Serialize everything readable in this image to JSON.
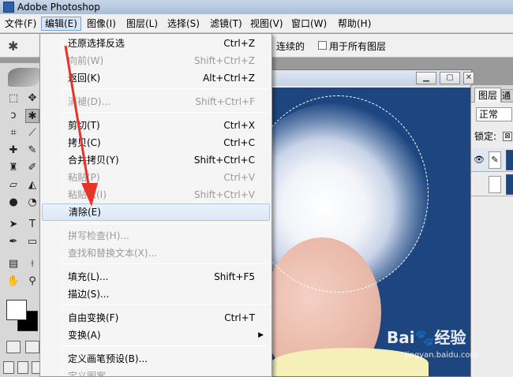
{
  "app": {
    "title": "Adobe Photoshop"
  },
  "menubar": {
    "items": [
      {
        "label": "文件(F)"
      },
      {
        "label": "编辑(E)"
      },
      {
        "label": "图像(I)"
      },
      {
        "label": "图层(L)"
      },
      {
        "label": "选择(S)"
      },
      {
        "label": "滤镜(T)"
      },
      {
        "label": "视图(V)"
      },
      {
        "label": "窗口(W)"
      },
      {
        "label": "帮助(H)"
      }
    ]
  },
  "options_bar": {
    "contiguous_label": "连续的",
    "all_layers_label": "用于所有图层"
  },
  "edit_menu": {
    "items": [
      {
        "label": "还原选择反选",
        "shortcut": "Ctrl+Z"
      },
      {
        "label": "向前(W)",
        "shortcut": "Shift+Ctrl+Z"
      },
      {
        "label": "返回(K)",
        "shortcut": "Alt+Ctrl+Z"
      },
      {
        "label": "消褪(D)...",
        "shortcut": "Shift+Ctrl+F"
      },
      {
        "label": "剪切(T)",
        "shortcut": "Ctrl+X"
      },
      {
        "label": "拷贝(C)",
        "shortcut": "Ctrl+C"
      },
      {
        "label": "合并拷贝(Y)",
        "shortcut": "Shift+Ctrl+C"
      },
      {
        "label": "粘贴(P)",
        "shortcut": "Ctrl+V"
      },
      {
        "label": "粘贴入(I)",
        "shortcut": "Shift+Ctrl+V"
      },
      {
        "label": "清除(E)",
        "shortcut": ""
      },
      {
        "label": "拼写检查(H)...",
        "shortcut": ""
      },
      {
        "label": "查找和替换文本(X)...",
        "shortcut": ""
      },
      {
        "label": "填充(L)...",
        "shortcut": "Shift+F5"
      },
      {
        "label": "描边(S)...",
        "shortcut": ""
      },
      {
        "label": "自由变换(F)",
        "shortcut": "Ctrl+T"
      },
      {
        "label": "变换(A)",
        "shortcut": ""
      },
      {
        "label": "定义画笔预设(B)...",
        "shortcut": ""
      },
      {
        "label": "定义图案",
        "shortcut": ""
      }
    ]
  },
  "layers_panel": {
    "tab_label": "图层",
    "tab2_label": "通",
    "blend_mode": "正常",
    "lock_label": "锁定:"
  },
  "watermark": {
    "brand": "Bai",
    "brand_suffix": "经验",
    "url": "jingyan.baidu.com"
  },
  "colors": {
    "highlight": "#dbe8f7",
    "canvas_bg": "#1d4680",
    "arrow": "#e8332a"
  }
}
